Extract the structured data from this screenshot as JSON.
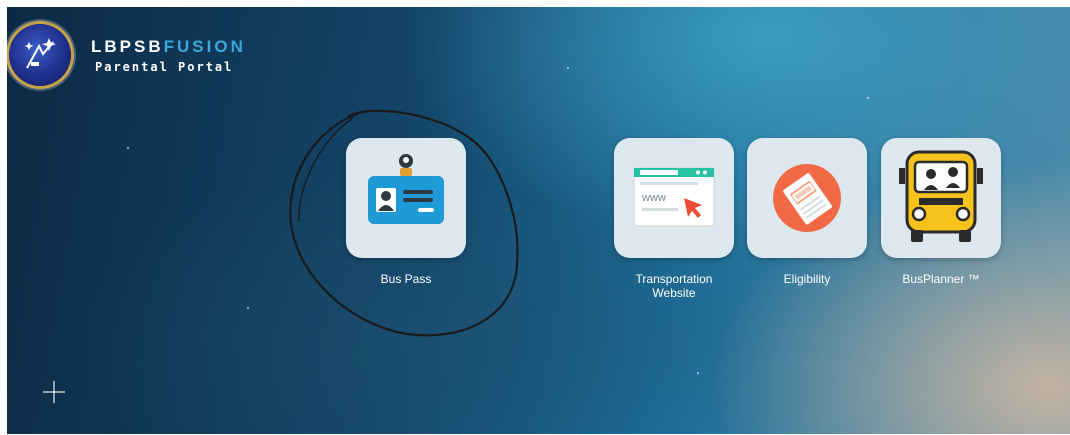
{
  "header": {
    "brand_primary": "LBPSB",
    "brand_secondary": "FUSION",
    "subtitle": "Parental Portal",
    "logo_icon": "stars-circle-logo"
  },
  "tiles": [
    {
      "label": "Bus Pass",
      "icon": "id-card-icon",
      "www": ""
    },
    {
      "label": "Transportation Website",
      "icon": "browser-window-icon",
      "www": "www"
    },
    {
      "label": "Eligibility",
      "icon": "ticket-icon"
    },
    {
      "label": "BusPlanner ™",
      "icon": "school-bus-icon"
    }
  ],
  "colors": {
    "brand_accent": "#3aa9e0",
    "tile_background": "#dde8ee",
    "id_card_blue": "#1f9ad6",
    "eligibility_orange": "#f26a45",
    "bus_yellow": "#f6c21b",
    "annotation_circle": "#1a1a1a"
  }
}
